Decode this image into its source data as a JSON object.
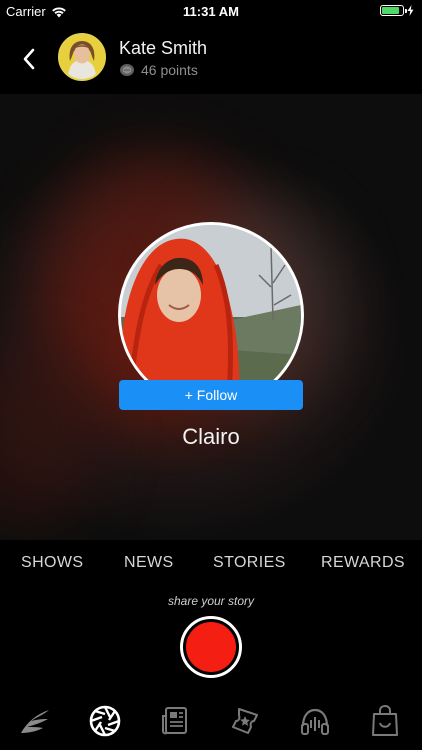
{
  "status_bar": {
    "carrier": "Carrier",
    "time": "11:31 AM",
    "battery_level": 0.85
  },
  "header": {
    "back_icon": "chevron-left-icon",
    "user_name": "Kate Smith",
    "points_text": "46 points",
    "points_icon": "coin-icon"
  },
  "artist": {
    "name": "Clairo",
    "follow_label": "+ Follow"
  },
  "tabs": [
    {
      "label": "SHOWS"
    },
    {
      "label": "NEWS"
    },
    {
      "label": "STORIES"
    },
    {
      "label": "REWARDS"
    }
  ],
  "share_caption": "share your story",
  "bottom_nav": [
    {
      "icon": "feather-wings-icon",
      "active": false
    },
    {
      "icon": "camera-aperture-icon",
      "active": true
    },
    {
      "icon": "newspaper-icon",
      "active": false
    },
    {
      "icon": "ticket-star-icon",
      "active": false
    },
    {
      "icon": "headphones-icon",
      "active": false
    },
    {
      "icon": "shopping-bag-icon",
      "active": false
    }
  ],
  "colors": {
    "accent": "#1a8ff5",
    "record": "#f41f12",
    "battery": "#4cd964",
    "avatar_ring": "#e4d24a"
  }
}
